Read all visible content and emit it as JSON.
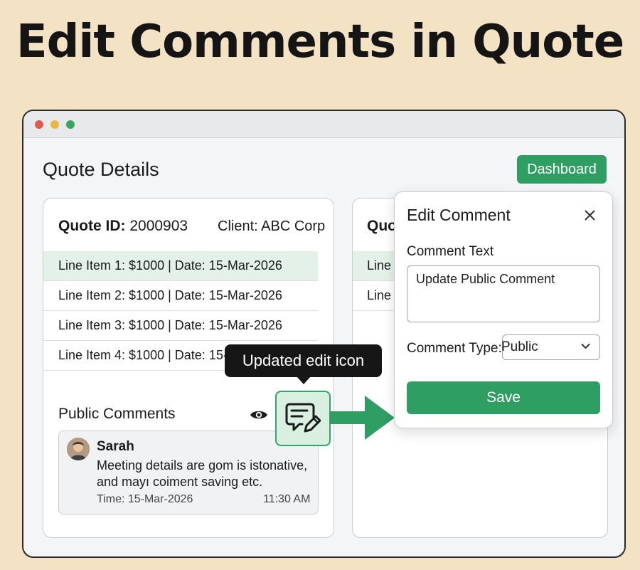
{
  "headline": "Edit Comments in Quote",
  "page": {
    "title": "Quote Details",
    "dashboard_label": "Dashboard"
  },
  "quote": {
    "id_label": "Quote ID:",
    "id_value": "2000903",
    "client": "Client: ABC Corp",
    "line_items": [
      "Line Item 1: $1000  | Date: 15-Mar-2026",
      "Line Item 2: $1000  | Date: 15-Mar-2026",
      "Line Item 3: $1000  | Date: 15-Mar-2026",
      "Line Item 4: $1000  | Date: 15-M"
    ]
  },
  "comments": {
    "section_label": "Public Comments",
    "author": "Sarah",
    "text": "Meeting details are gom is istonative, and mayı coiment saving etc.",
    "time": "Time: 15-Mar-2026",
    "clock": "11:30 AM"
  },
  "right_card": {
    "fragment_title": "Quo",
    "fragment_lines": [
      "Line",
      "Line"
    ]
  },
  "tooltip": "Updated edit icon",
  "modal": {
    "title": "Edit Comment",
    "comment_text_label": "Comment Text",
    "comment_text_value": "Update Public Comment",
    "comment_type_label": "Comment Type:",
    "comment_type_value": "Public",
    "save_label": "Save"
  },
  "icons": {
    "close": "close-icon",
    "eye": "eye-icon",
    "edit": "comment-edit-icon",
    "chevron": "chevron-down-icon"
  },
  "colors": {
    "accent": "#2f9e63",
    "background": "#f3e2c4",
    "selected_row": "#e3f1e8"
  }
}
